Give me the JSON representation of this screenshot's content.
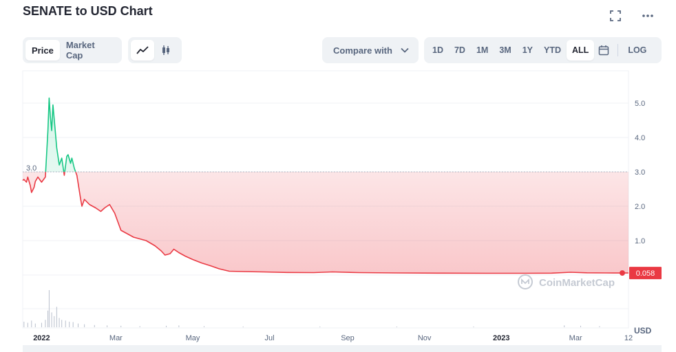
{
  "title": "SENATE to USD Chart",
  "icons": {
    "fullscreen": "fullscreen-icon",
    "more": "more-icon",
    "line": "line-chart-icon",
    "candle": "candlestick-icon",
    "chevron": "chevron-down-icon",
    "calendar": "calendar-icon"
  },
  "price_type_tabs": [
    {
      "label": "Price",
      "active": true
    },
    {
      "label": "Market Cap",
      "active": false
    }
  ],
  "compare": {
    "label": "Compare with"
  },
  "ranges": [
    {
      "label": "1D",
      "active": false
    },
    {
      "label": "7D",
      "active": false
    },
    {
      "label": "1M",
      "active": false
    },
    {
      "label": "3M",
      "active": false
    },
    {
      "label": "1Y",
      "active": false
    },
    {
      "label": "YTD",
      "active": false
    },
    {
      "label": "ALL",
      "active": true
    }
  ],
  "log_label": "LOG",
  "watermark": "CoinMarketCap",
  "colors": {
    "up": "#16c784",
    "down": "#ea3943",
    "accent": "#3861fb",
    "text_muted": "#58667e"
  },
  "chart_data": {
    "type": "line",
    "pair": "SENATE/USD",
    "currency_label": "USD",
    "y_ticks": [
      "1.0",
      "2.0",
      "3.0",
      "4.0",
      "5.0"
    ],
    "ylim": [
      0,
      6
    ],
    "baseline": {
      "value": 3.0,
      "label": "3.0"
    },
    "last_price": {
      "label": "0.058",
      "value": 0.058
    },
    "x_tick_labels": [
      {
        "label": "2022",
        "date": "2022-01-01",
        "bold": true
      },
      {
        "label": "Mar",
        "date": "2022-03-01"
      },
      {
        "label": "May",
        "date": "2022-05-01"
      },
      {
        "label": "Jul",
        "date": "2022-07-01"
      },
      {
        "label": "Sep",
        "date": "2022-09-01"
      },
      {
        "label": "Nov",
        "date": "2022-11-01"
      },
      {
        "label": "2023",
        "date": "2023-01-01",
        "bold": true
      },
      {
        "label": "Mar",
        "date": "2023-03-01"
      },
      {
        "label": "12",
        "date": "2023-04-12"
      }
    ],
    "x_range": [
      "2021-12-17",
      "2023-04-12"
    ],
    "series": [
      {
        "points": [
          [
            "2021-12-17",
            2.75
          ],
          [
            "2021-12-18",
            2.78
          ],
          [
            "2021-12-20",
            2.7
          ],
          [
            "2021-12-21",
            2.85
          ],
          [
            "2021-12-23",
            2.6
          ],
          [
            "2021-12-24",
            2.4
          ],
          [
            "2021-12-26",
            2.55
          ],
          [
            "2021-12-27",
            2.72
          ],
          [
            "2021-12-29",
            2.85
          ],
          [
            "2022-01-01",
            2.7
          ],
          [
            "2022-01-04",
            2.85
          ],
          [
            "2022-01-06",
            4.2
          ],
          [
            "2022-01-07",
            5.15
          ],
          [
            "2022-01-08",
            4.6
          ],
          [
            "2022-01-09",
            4.2
          ],
          [
            "2022-01-10",
            4.95
          ],
          [
            "2022-01-11",
            4.55
          ],
          [
            "2022-01-13",
            3.7
          ],
          [
            "2022-01-15",
            3.2
          ],
          [
            "2022-01-17",
            3.4
          ],
          [
            "2022-01-19",
            2.9
          ],
          [
            "2022-01-21",
            3.45
          ],
          [
            "2022-01-22",
            3.5
          ],
          [
            "2022-01-24",
            3.25
          ],
          [
            "2022-01-25",
            3.4
          ],
          [
            "2022-01-27",
            3.1
          ],
          [
            "2022-01-29",
            2.9
          ],
          [
            "2022-02-01",
            2.2
          ],
          [
            "2022-02-02",
            2.0
          ],
          [
            "2022-02-04",
            2.2
          ],
          [
            "2022-02-08",
            2.05
          ],
          [
            "2022-02-13",
            1.95
          ],
          [
            "2022-02-17",
            1.85
          ],
          [
            "2022-02-20",
            1.95
          ],
          [
            "2022-02-24",
            2.05
          ],
          [
            "2022-02-28",
            1.8
          ],
          [
            "2022-03-05",
            1.3
          ],
          [
            "2022-03-10",
            1.2
          ],
          [
            "2022-03-15",
            1.1
          ],
          [
            "2022-03-20",
            1.05
          ],
          [
            "2022-03-25",
            1.0
          ],
          [
            "2022-04-01",
            0.85
          ],
          [
            "2022-04-06",
            0.7
          ],
          [
            "2022-04-09",
            0.58
          ],
          [
            "2022-04-13",
            0.62
          ],
          [
            "2022-04-16",
            0.75
          ],
          [
            "2022-04-20",
            0.65
          ],
          [
            "2022-04-25",
            0.55
          ],
          [
            "2022-05-01",
            0.45
          ],
          [
            "2022-05-08",
            0.35
          ],
          [
            "2022-05-15",
            0.27
          ],
          [
            "2022-05-22",
            0.18
          ],
          [
            "2022-05-30",
            0.11
          ],
          [
            "2022-06-10",
            0.1
          ],
          [
            "2022-06-25",
            0.09
          ],
          [
            "2022-07-15",
            0.075
          ],
          [
            "2022-08-05",
            0.07
          ],
          [
            "2022-08-20",
            0.09
          ],
          [
            "2022-09-10",
            0.07
          ],
          [
            "2022-10-10",
            0.06
          ],
          [
            "2022-11-15",
            0.055
          ],
          [
            "2022-12-20",
            0.05
          ],
          [
            "2023-01-20",
            0.05
          ],
          [
            "2023-02-10",
            0.055
          ],
          [
            "2023-02-25",
            0.08
          ],
          [
            "2023-03-10",
            0.065
          ],
          [
            "2023-03-25",
            0.06
          ],
          [
            "2023-04-12",
            0.058
          ]
        ]
      }
    ],
    "volume": {
      "points": [
        [
          "2021-12-18",
          0.15
        ],
        [
          "2021-12-21",
          0.12
        ],
        [
          "2021-12-24",
          0.18
        ],
        [
          "2021-12-27",
          0.1
        ],
        [
          "2022-01-01",
          0.12
        ],
        [
          "2022-01-04",
          0.2
        ],
        [
          "2022-01-06",
          0.45
        ],
        [
          "2022-01-07",
          1.0
        ],
        [
          "2022-01-09",
          0.4
        ],
        [
          "2022-01-11",
          0.3
        ],
        [
          "2022-01-13",
          0.55
        ],
        [
          "2022-01-15",
          0.25
        ],
        [
          "2022-01-17",
          0.2
        ],
        [
          "2022-01-20",
          0.18
        ],
        [
          "2022-01-23",
          0.15
        ],
        [
          "2022-01-26",
          0.14
        ],
        [
          "2022-01-30",
          0.1
        ],
        [
          "2022-02-04",
          0.08
        ],
        [
          "2022-02-12",
          0.06
        ],
        [
          "2022-02-22",
          0.05
        ],
        [
          "2022-03-05",
          0.04
        ],
        [
          "2022-03-20",
          0.03
        ],
        [
          "2022-04-10",
          0.04
        ],
        [
          "2022-04-20",
          0.05
        ],
        [
          "2022-05-10",
          0.03
        ],
        [
          "2022-06-10",
          0.02
        ],
        [
          "2022-08-10",
          0.02
        ],
        [
          "2022-10-10",
          0.02
        ],
        [
          "2022-12-10",
          0.02
        ],
        [
          "2023-02-20",
          0.05
        ],
        [
          "2023-03-05",
          0.04
        ],
        [
          "2023-03-20",
          0.03
        ]
      ]
    }
  }
}
